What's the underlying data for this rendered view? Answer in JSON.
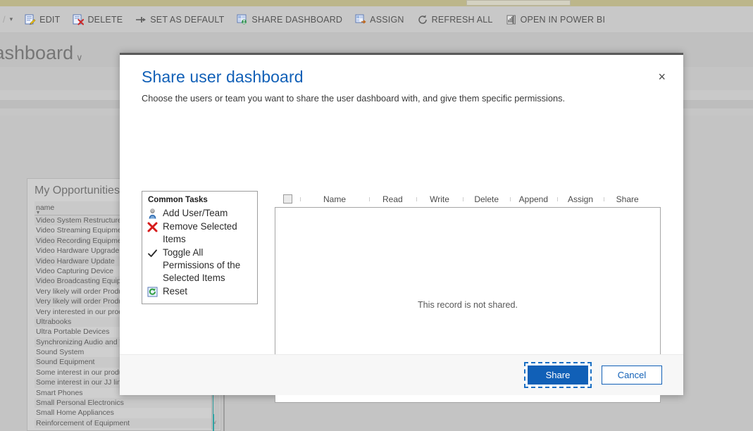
{
  "background": {
    "command_bar": {
      "leading_caret": "▾",
      "items": [
        {
          "label": "EDIT",
          "icon": "edit-icon"
        },
        {
          "label": "DELETE",
          "icon": "delete-icon"
        },
        {
          "label": "SET AS DEFAULT",
          "icon": "pin-icon"
        },
        {
          "label": "SHARE DASHBOARD",
          "icon": "share-dashboard-icon"
        },
        {
          "label": "ASSIGN",
          "icon": "assign-icon"
        },
        {
          "label": "REFRESH ALL",
          "icon": "refresh-icon"
        },
        {
          "label": "OPEN IN POWER BI",
          "icon": "power-bi-icon"
        }
      ]
    },
    "page_title": "Dashboard",
    "page_title_caret": "∨",
    "widget": {
      "title": "My Opportunities",
      "column_header": "name",
      "sort_caret": "▾",
      "rows": [
        "Video System Restructure",
        "Video Streaming Equipment",
        "Video Recording Equipment",
        "Video Hardware Upgrade",
        "Video Hardware Update",
        "Video Capturing Device",
        "Video Broadcasting Equipment",
        "Very likely will order Product S",
        "Very likely will order Product S",
        "Very interested in our products",
        "Ultrabooks",
        "Ultra Portable Devices",
        "Synchronizing Audio and Video",
        "Sound System",
        "Sound Equipment",
        "Some interest in our products",
        "Some interest in our JJ line of",
        "Smart Phones",
        "Small Personal Electronics",
        "Small Home Appliances",
        "Reinforcement of Equipment"
      ],
      "scroll_down_arrow": "∨"
    }
  },
  "dialog": {
    "title": "Share user dashboard",
    "subtitle": "Choose the users or team you want to share the user dashboard with, and give them specific permissions.",
    "close_label": "×",
    "common_tasks": {
      "title": "Common Tasks",
      "items": [
        {
          "label": "Add User/Team",
          "icon": "add-user-icon"
        },
        {
          "label": "Remove Selected Items",
          "icon": "remove-x-icon"
        },
        {
          "label": "Toggle All Permissions of the Selected Items",
          "icon": "check-icon"
        },
        {
          "label": "Reset",
          "icon": "reset-icon"
        }
      ]
    },
    "grid": {
      "columns": [
        "Name",
        "Read",
        "Write",
        "Delete",
        "Append",
        "Assign",
        "Share"
      ],
      "select_all_checkbox": "unchecked",
      "empty_message": "This record is not shared.",
      "rows": []
    },
    "footer": {
      "share_label": "Share",
      "cancel_label": "Cancel"
    }
  },
  "colors": {
    "accent_blue": "#1160b7",
    "top_strip": "#bcb68a",
    "dim_overlay": "#c4c4c4"
  }
}
